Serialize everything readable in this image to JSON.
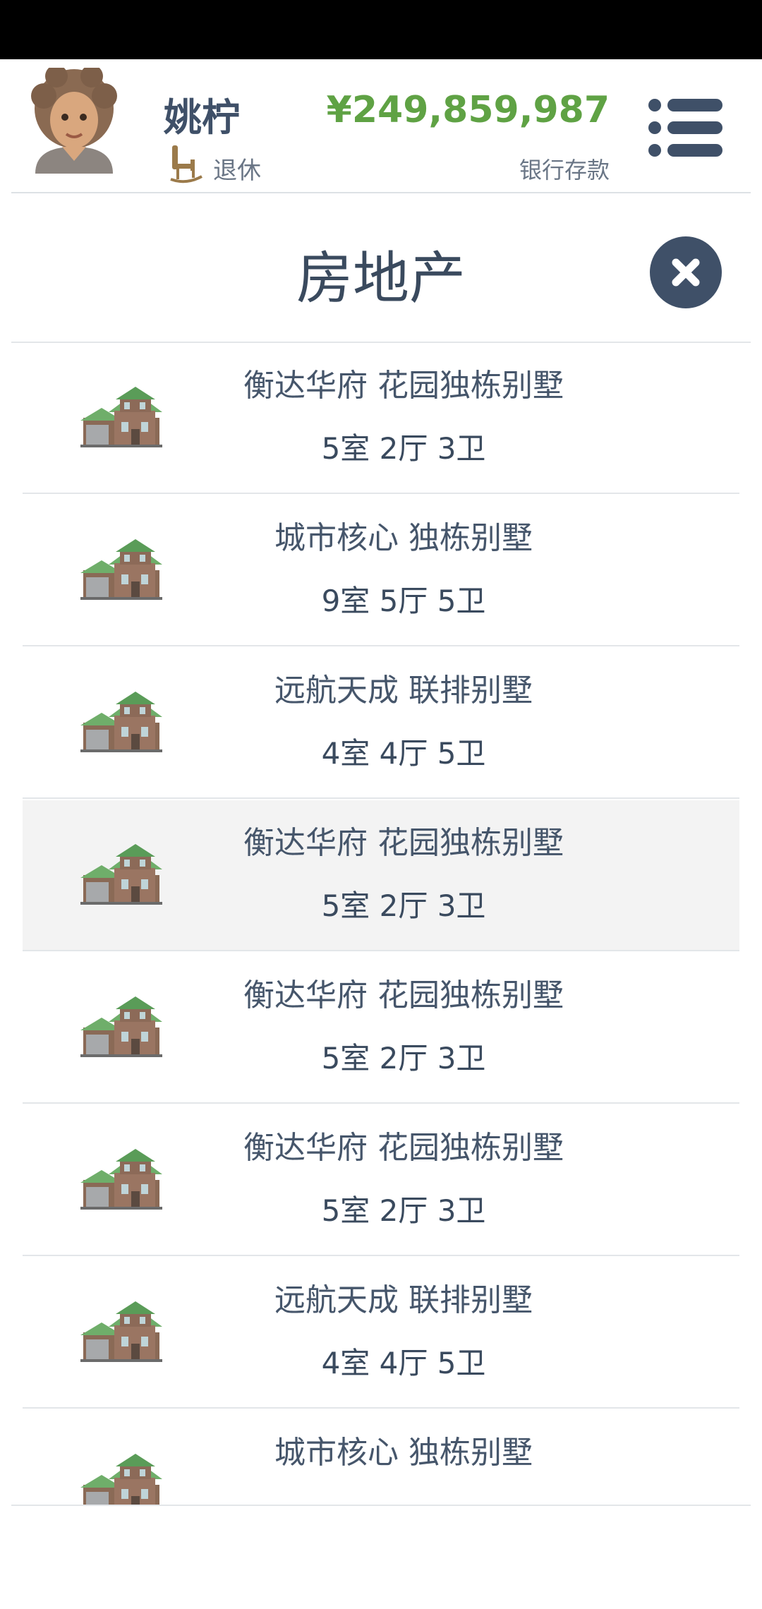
{
  "player": {
    "name": "姚柠",
    "status": "退休",
    "balance": "¥249,859,987",
    "balance_label": "银行存款"
  },
  "panel": {
    "title": "房地产"
  },
  "properties": [
    {
      "name": "衡达华府 花园独栋别墅",
      "rooms": "5室 2厅 3卫"
    },
    {
      "name": "城市核心 独栋别墅",
      "rooms": "9室 5厅 5卫"
    },
    {
      "name": "远航天成 联排别墅",
      "rooms": "4室 4厅 5卫"
    },
    {
      "name": "衡达华府 花园独栋别墅",
      "rooms": "5室 2厅 3卫"
    },
    {
      "name": "衡达华府 花园独栋别墅",
      "rooms": "5室 2厅 3卫"
    },
    {
      "name": "衡达华府 花园独栋别墅",
      "rooms": "5室 2厅 3卫"
    },
    {
      "name": "远航天成 联排别墅",
      "rooms": "4室 4厅 5卫"
    },
    {
      "name": "城市核心 独栋别墅",
      "rooms": ""
    }
  ],
  "selected_index": 3,
  "colors": {
    "accent": "#5fa244",
    "dark": "#3f5068",
    "selected_bg": "#f3f3f3"
  }
}
